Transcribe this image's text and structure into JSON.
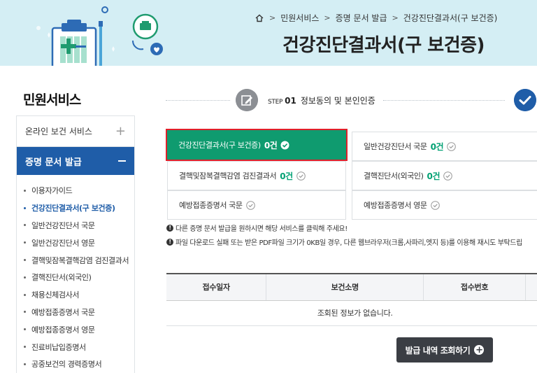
{
  "breadcrumb": {
    "items": [
      "민원서비스",
      "증명 문서 발급",
      "건강진단결과서(구 보건증)"
    ]
  },
  "page_title": "건강진단결과서(구 보건증)",
  "sidebar": {
    "heading": "민원서비스",
    "top_item": "온라인 보건 서비스",
    "active_section": "증명 문서 발급",
    "items": [
      {
        "label": "이용자가이드"
      },
      {
        "label": "건강진단결과서(구 보건증)"
      },
      {
        "label": "일반건강진단서 국문"
      },
      {
        "label": "일반건강진단서 영문"
      },
      {
        "label": "결핵및잠복결핵감염 검진결과서"
      },
      {
        "label": "결핵진단서(외국인)"
      },
      {
        "label": "채용신체검사서"
      },
      {
        "label": "예방접종증명서 국문"
      },
      {
        "label": "예방접종증명서 영문"
      },
      {
        "label": "진료비납입증명서"
      },
      {
        "label": "공중보건의 경력증명서"
      }
    ]
  },
  "step": {
    "label": "STEP",
    "number": "01",
    "title": "정보동의 및 본인인증"
  },
  "documents": [
    {
      "name": "건강진단결과서(구 보건증)",
      "count": "0건",
      "selected": true
    },
    {
      "name": "일반건강진단서 국문",
      "count": "0건",
      "selected": false
    },
    {
      "name": "결핵및잠복결핵감염 검진결과서",
      "count": "0건",
      "selected": false
    },
    {
      "name": "결핵진단서(외국인)",
      "count": "0건",
      "selected": false
    },
    {
      "name": "예방접종증명서 국문",
      "count": "",
      "selected": false
    },
    {
      "name": "예방접종증명서 영문",
      "count": "",
      "selected": false
    }
  ],
  "notices": [
    "다른 증명 문서 발급을 원하시면 해당 서비스를 클릭해 주세요!",
    "파일 다운로드 실패 또는 받은 PDF파일 크기가 0KB일 경우, 다른 웹브라우저(크롬,사파리,엣지 등)를 이용해 재시도 부탁드립"
  ],
  "table": {
    "headers": [
      "접수일자",
      "보건소명",
      "접수번호"
    ],
    "empty_message": "조회된 정보가 없습니다."
  },
  "history_button": "발급 내역 조회하기",
  "colors": {
    "banner_bg": "#d4eef4",
    "primary_blue": "#1f5da8",
    "selected_green": "#0f9b6f",
    "count_green": "#00a173",
    "highlight_red": "#e0202a"
  }
}
